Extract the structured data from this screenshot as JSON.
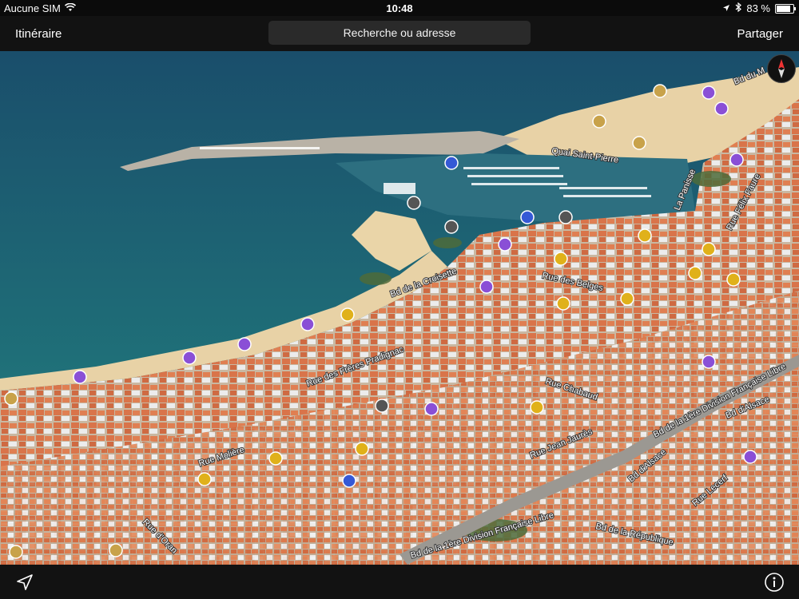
{
  "status": {
    "carrier": "Aucune SIM",
    "time": "10:48",
    "battery": "83 %",
    "battery_level": 0.83
  },
  "nav": {
    "left_button": "Itinéraire",
    "search_placeholder": "Recherche ou adresse",
    "right_button": "Partager"
  },
  "map": {
    "streets": [
      "Bd du M",
      "Quai Saint-Pierre",
      "La Panisse",
      "Rue Félix Faure",
      "Bd de la Croisette",
      "Rue des Belges",
      "Rue des Frères Pradignac",
      "Rue Chabaud",
      "Bd de la 1ère Division Française Libre",
      "Bd d'Alsace",
      "Rue Molière",
      "Rue Jean Jaurès",
      "Bd d'Alsace",
      "Rue Lecerf",
      "Rue d'Oran",
      "Bd de la République",
      "Bd de la 1ère Division Française Libre"
    ],
    "colors": {
      "sea": "#1f6f78",
      "sea_deep": "#1a4e6b",
      "beach": "#e8d2a6",
      "roof": "#d9744a",
      "land": "#b7a58d"
    }
  },
  "bottom": {
    "location_icon": "location-arrow-icon",
    "info_icon": "info-icon"
  }
}
